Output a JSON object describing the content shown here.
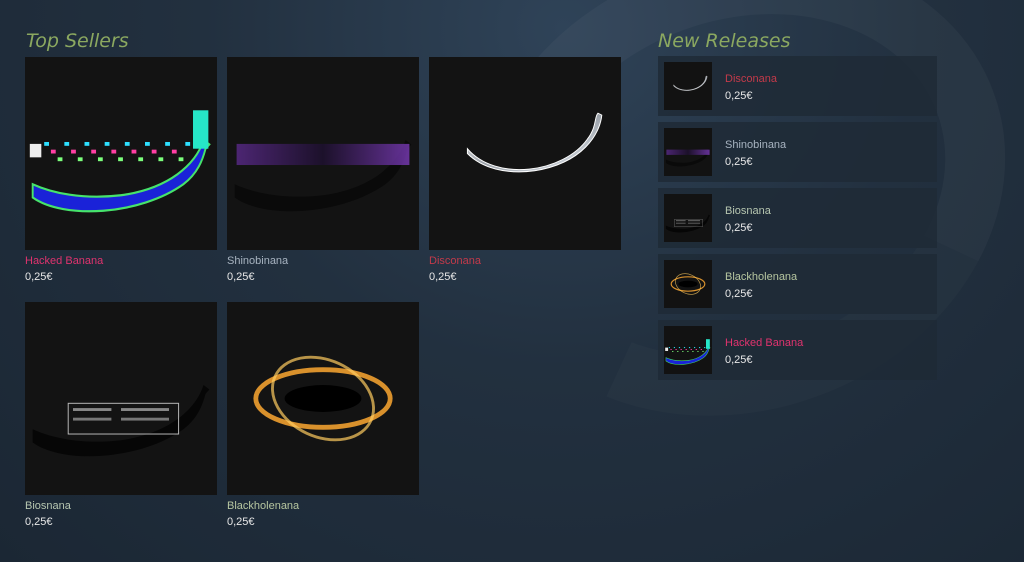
{
  "top_sellers": {
    "title": "Top Sellers",
    "items": [
      {
        "name": "Hacked Banana",
        "price": "0,25€",
        "name_color": "#e0336e",
        "art": "hacked"
      },
      {
        "name": "Shinobinana",
        "price": "0,25€",
        "name_color": "#a7b3c0",
        "art": "shinobi"
      },
      {
        "name": "Disconana",
        "price": "0,25€",
        "name_color": "#c33a4a",
        "art": "disco"
      },
      {
        "name": "Biosnana",
        "price": "0,25€",
        "name_color": "#b6c6b0",
        "art": "bios"
      },
      {
        "name": "Blackholenana",
        "price": "0,25€",
        "name_color": "#b6c6a0",
        "art": "blackhole"
      }
    ]
  },
  "new_releases": {
    "title": "New Releases",
    "items": [
      {
        "name": "Disconana",
        "price": "0,25€",
        "name_color": "#c33a4a",
        "art": "disco"
      },
      {
        "name": "Shinobinana",
        "price": "0,25€",
        "name_color": "#a7b3c0",
        "art": "shinobi"
      },
      {
        "name": "Biosnana",
        "price": "0,25€",
        "name_color": "#b6c6b0",
        "art": "bios"
      },
      {
        "name": "Blackholenana",
        "price": "0,25€",
        "name_color": "#b6c6a0",
        "art": "blackhole"
      },
      {
        "name": "Hacked Banana",
        "price": "0,25€",
        "name_color": "#e0336e",
        "art": "hacked"
      }
    ]
  },
  "colors": {
    "section_title": "#8ba860",
    "price": "#e8e8e8"
  }
}
